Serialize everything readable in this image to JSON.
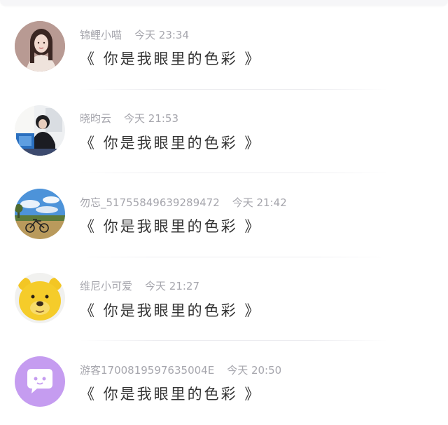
{
  "comments": [
    {
      "username": "锦鲤小喵",
      "time": "今天 23:34",
      "text": "《 你是我眼里的色彩 》",
      "avatar_icon": "avatar-girl-photo"
    },
    {
      "username": "晓昀云",
      "time": "今天 21:53",
      "text": "《 你是我眼里的色彩 》",
      "avatar_icon": "avatar-boy-at-desk-photo"
    },
    {
      "username": "勿忘_51755849639289472",
      "time": "今天 21:42",
      "text": "《 你是我眼里的色彩 》",
      "avatar_icon": "avatar-bicycle-field-photo"
    },
    {
      "username": "维尼小可爱",
      "time": "今天 21:27",
      "text": "《 你是我眼里的色彩 》",
      "avatar_icon": "avatar-winnie-bear"
    },
    {
      "username": "游客1700819597635004E",
      "time": "今天 20:50",
      "text": "《 你是我眼里的色彩 》",
      "avatar_icon": "avatar-guest-chat-bubble"
    }
  ]
}
